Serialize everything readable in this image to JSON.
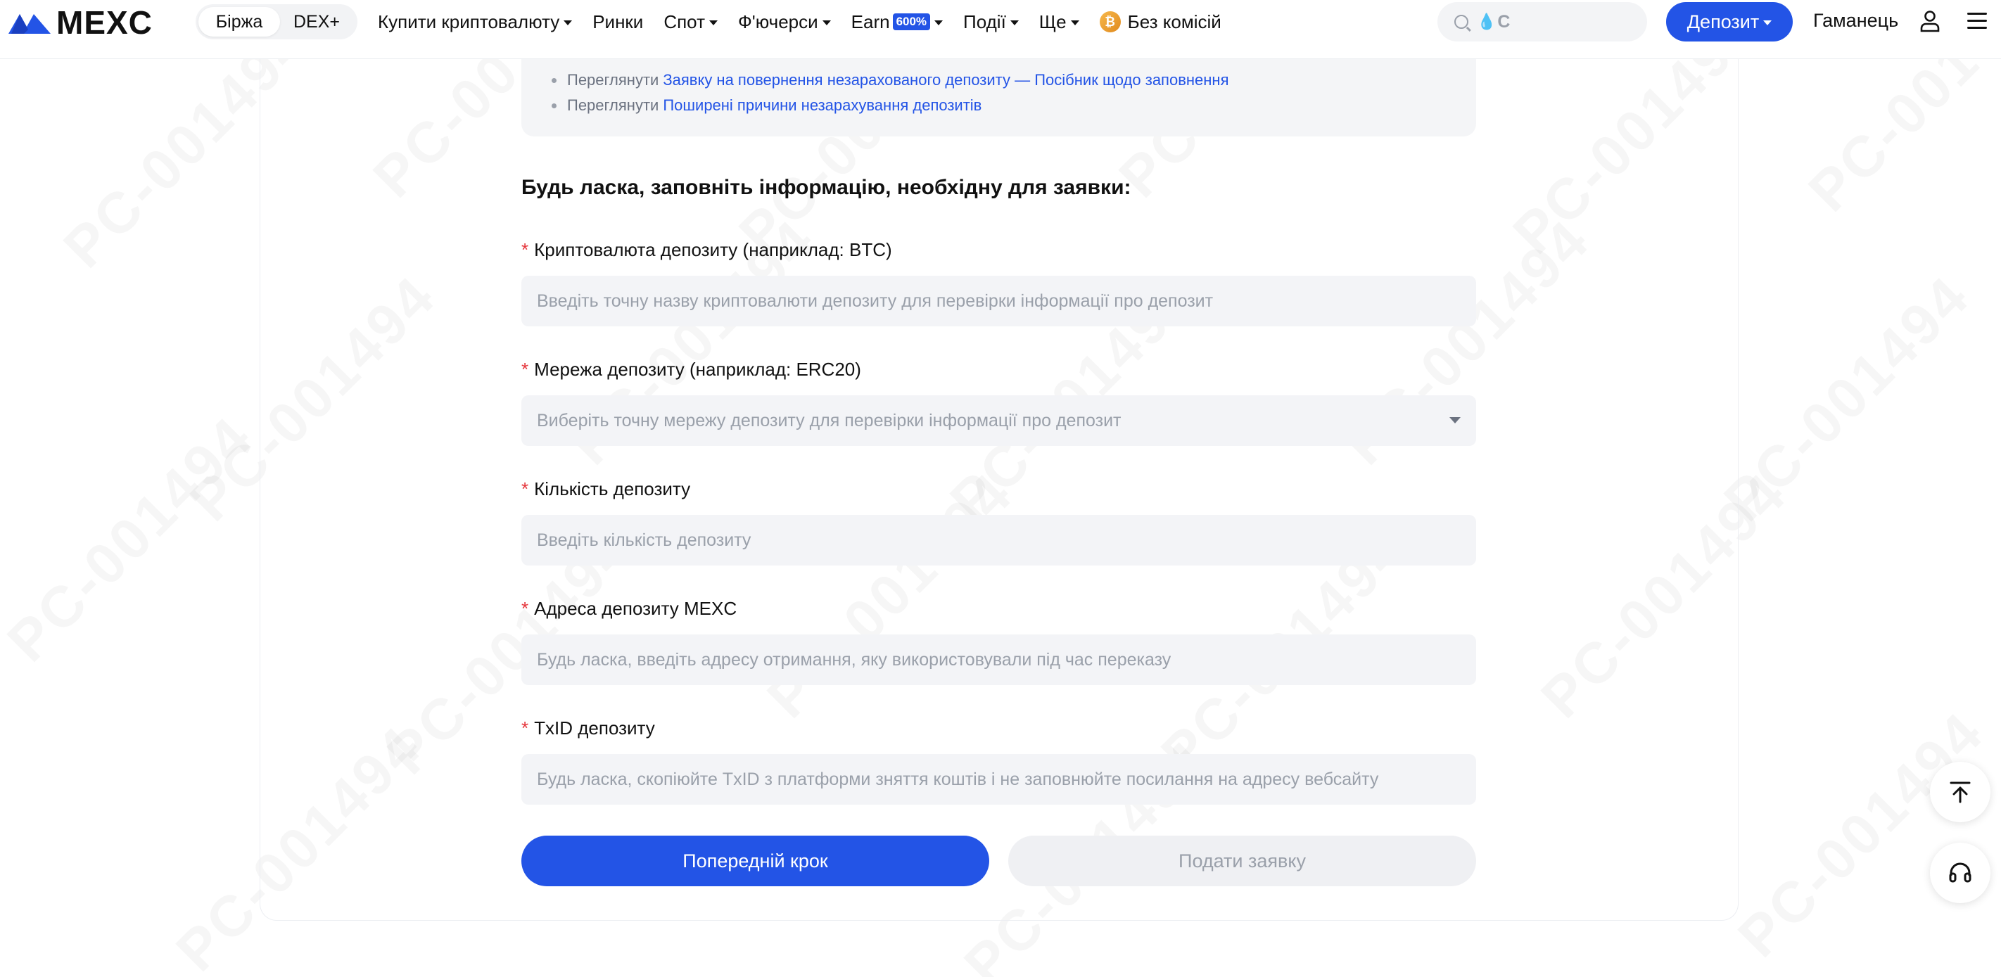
{
  "header": {
    "logo_text": "MEXC",
    "modes": [
      "Біржа",
      "DEX+"
    ],
    "nav": [
      {
        "label": "Купити криптовалюту",
        "dropdown": true
      },
      {
        "label": "Ринки",
        "dropdown": false
      },
      {
        "label": "Спот",
        "dropdown": true
      },
      {
        "label": "Ф'ючерси",
        "dropdown": true
      },
      {
        "label": "Earn",
        "badge": "600%",
        "dropdown": true
      },
      {
        "label": "Події",
        "dropdown": true
      },
      {
        "label": "Ще",
        "dropdown": true
      },
      {
        "label": "Без комісій",
        "dropdown": false
      }
    ],
    "search_placeholder": "C",
    "deposit_label": "Депозит",
    "wallet_label": "Гаманець"
  },
  "tips": {
    "prefix": "Переглянути",
    "links": [
      "Заявку на повернення незарахованого депозиту — Посібник щодо заповнення",
      "Поширені причини незарахування депозитів"
    ]
  },
  "form": {
    "title": "Будь ласка, заповніть інформацію, необхідну для заявки:",
    "required_mark": "*",
    "fields": [
      {
        "label": "Криптовалюта депозиту (наприклад: BTC)",
        "placeholder": "Введіть точну назву криптовалюти депозиту для перевірки інформації про депозит"
      },
      {
        "label": "Мережа депозиту (наприклад: ERC20)",
        "placeholder": "Виберіть точну мережу депозиту для перевірки інформації про депозит"
      },
      {
        "label": "Кількість депозиту",
        "placeholder": "Введіть кількість депозиту"
      },
      {
        "label": "Адреса депозиту MEXC",
        "placeholder": "Будь ласка, введіть адресу отримання, яку використовували під час переказу"
      },
      {
        "label": "TxID депозиту",
        "placeholder": "Будь ласка, скопіюйте TxID з платформи зняття коштів і не заповнюйте посилання на адресу вебсайту"
      }
    ],
    "prev_button": "Попередній крок",
    "submit_button": "Подати заявку"
  },
  "watermark_text": "PC-001494",
  "colors": {
    "accent": "#2354e6",
    "required": "#e5343a"
  }
}
